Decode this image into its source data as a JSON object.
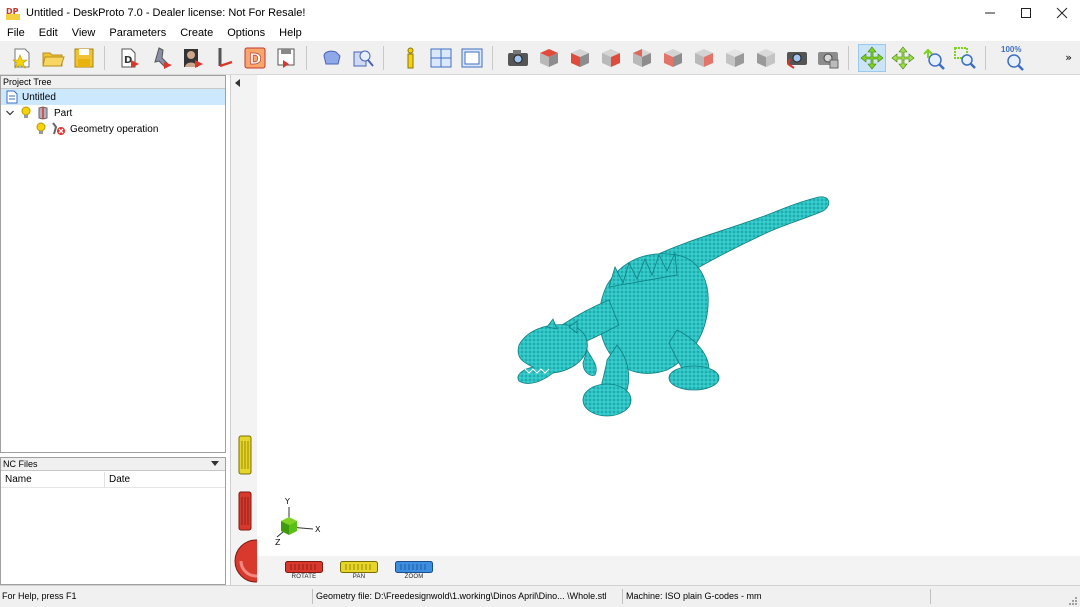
{
  "window": {
    "title": "Untitled - DeskProto 7.0 - Dealer license: Not For Resale!",
    "controls": [
      "minimize-icon",
      "maximize-icon",
      "close-icon"
    ]
  },
  "menu": {
    "items": [
      "File",
      "Edit",
      "View",
      "Parameters",
      "Create",
      "Options",
      "Help"
    ]
  },
  "toolbar": {
    "zoom_percent": "100%",
    "buttons": [
      "new-project-icon",
      "open-project-icon",
      "save-project-icon",
      "wizard-geometry-icon",
      "wizard-2d-icon",
      "wizard-bitmap-icon",
      "wizard-rotary-icon",
      "dmode-icon",
      "export-icon",
      "render-icon",
      "inspect-icon",
      "info-icon",
      "layout-icon",
      "viewport-icon",
      "camera-icon",
      "view-top-icon",
      "view-front-icon",
      "view-right-icon",
      "view-back-icon",
      "view-left-icon",
      "view-bottom-icon",
      "view-iso-icon",
      "view-iso2-icon",
      "camera-reset-icon",
      "camera-settings-icon",
      "rotate-mode-icon",
      "pan-mode-icon",
      "zoom-mode-icon",
      "zoom-window-icon",
      "zoom-100-icon"
    ],
    "more_label": "»"
  },
  "project_tree": {
    "header": "Project Tree",
    "items": [
      {
        "label": "Untitled",
        "icon": "document-icon",
        "level": 0,
        "selected": true
      },
      {
        "label": "Part",
        "icon": "part-icon",
        "level": 1
      },
      {
        "label": "Geometry operation",
        "icon": "geometry-icon",
        "level": 2
      }
    ]
  },
  "nc_files": {
    "header": "NC Files",
    "columns": [
      "Name",
      "Date"
    ]
  },
  "viewport": {
    "nav_buttons": [
      {
        "label": "ROTATE",
        "color": "#d9382d"
      },
      {
        "label": "PAN",
        "color": "#e6d52a"
      },
      {
        "label": "ZOOM",
        "color": "#3d8ee0"
      }
    ],
    "axes": {
      "x": "X",
      "y": "Y",
      "z": "Z"
    },
    "model_color": "#2ec4c4"
  },
  "status": {
    "help": "For Help, press F1",
    "geometry_file": "Geometry file: D:\\Freedesignwold\\1.working\\Dinos April\\Dino... \\Whole.stl",
    "machine": "Machine: ISO plain G-codes - mm"
  }
}
